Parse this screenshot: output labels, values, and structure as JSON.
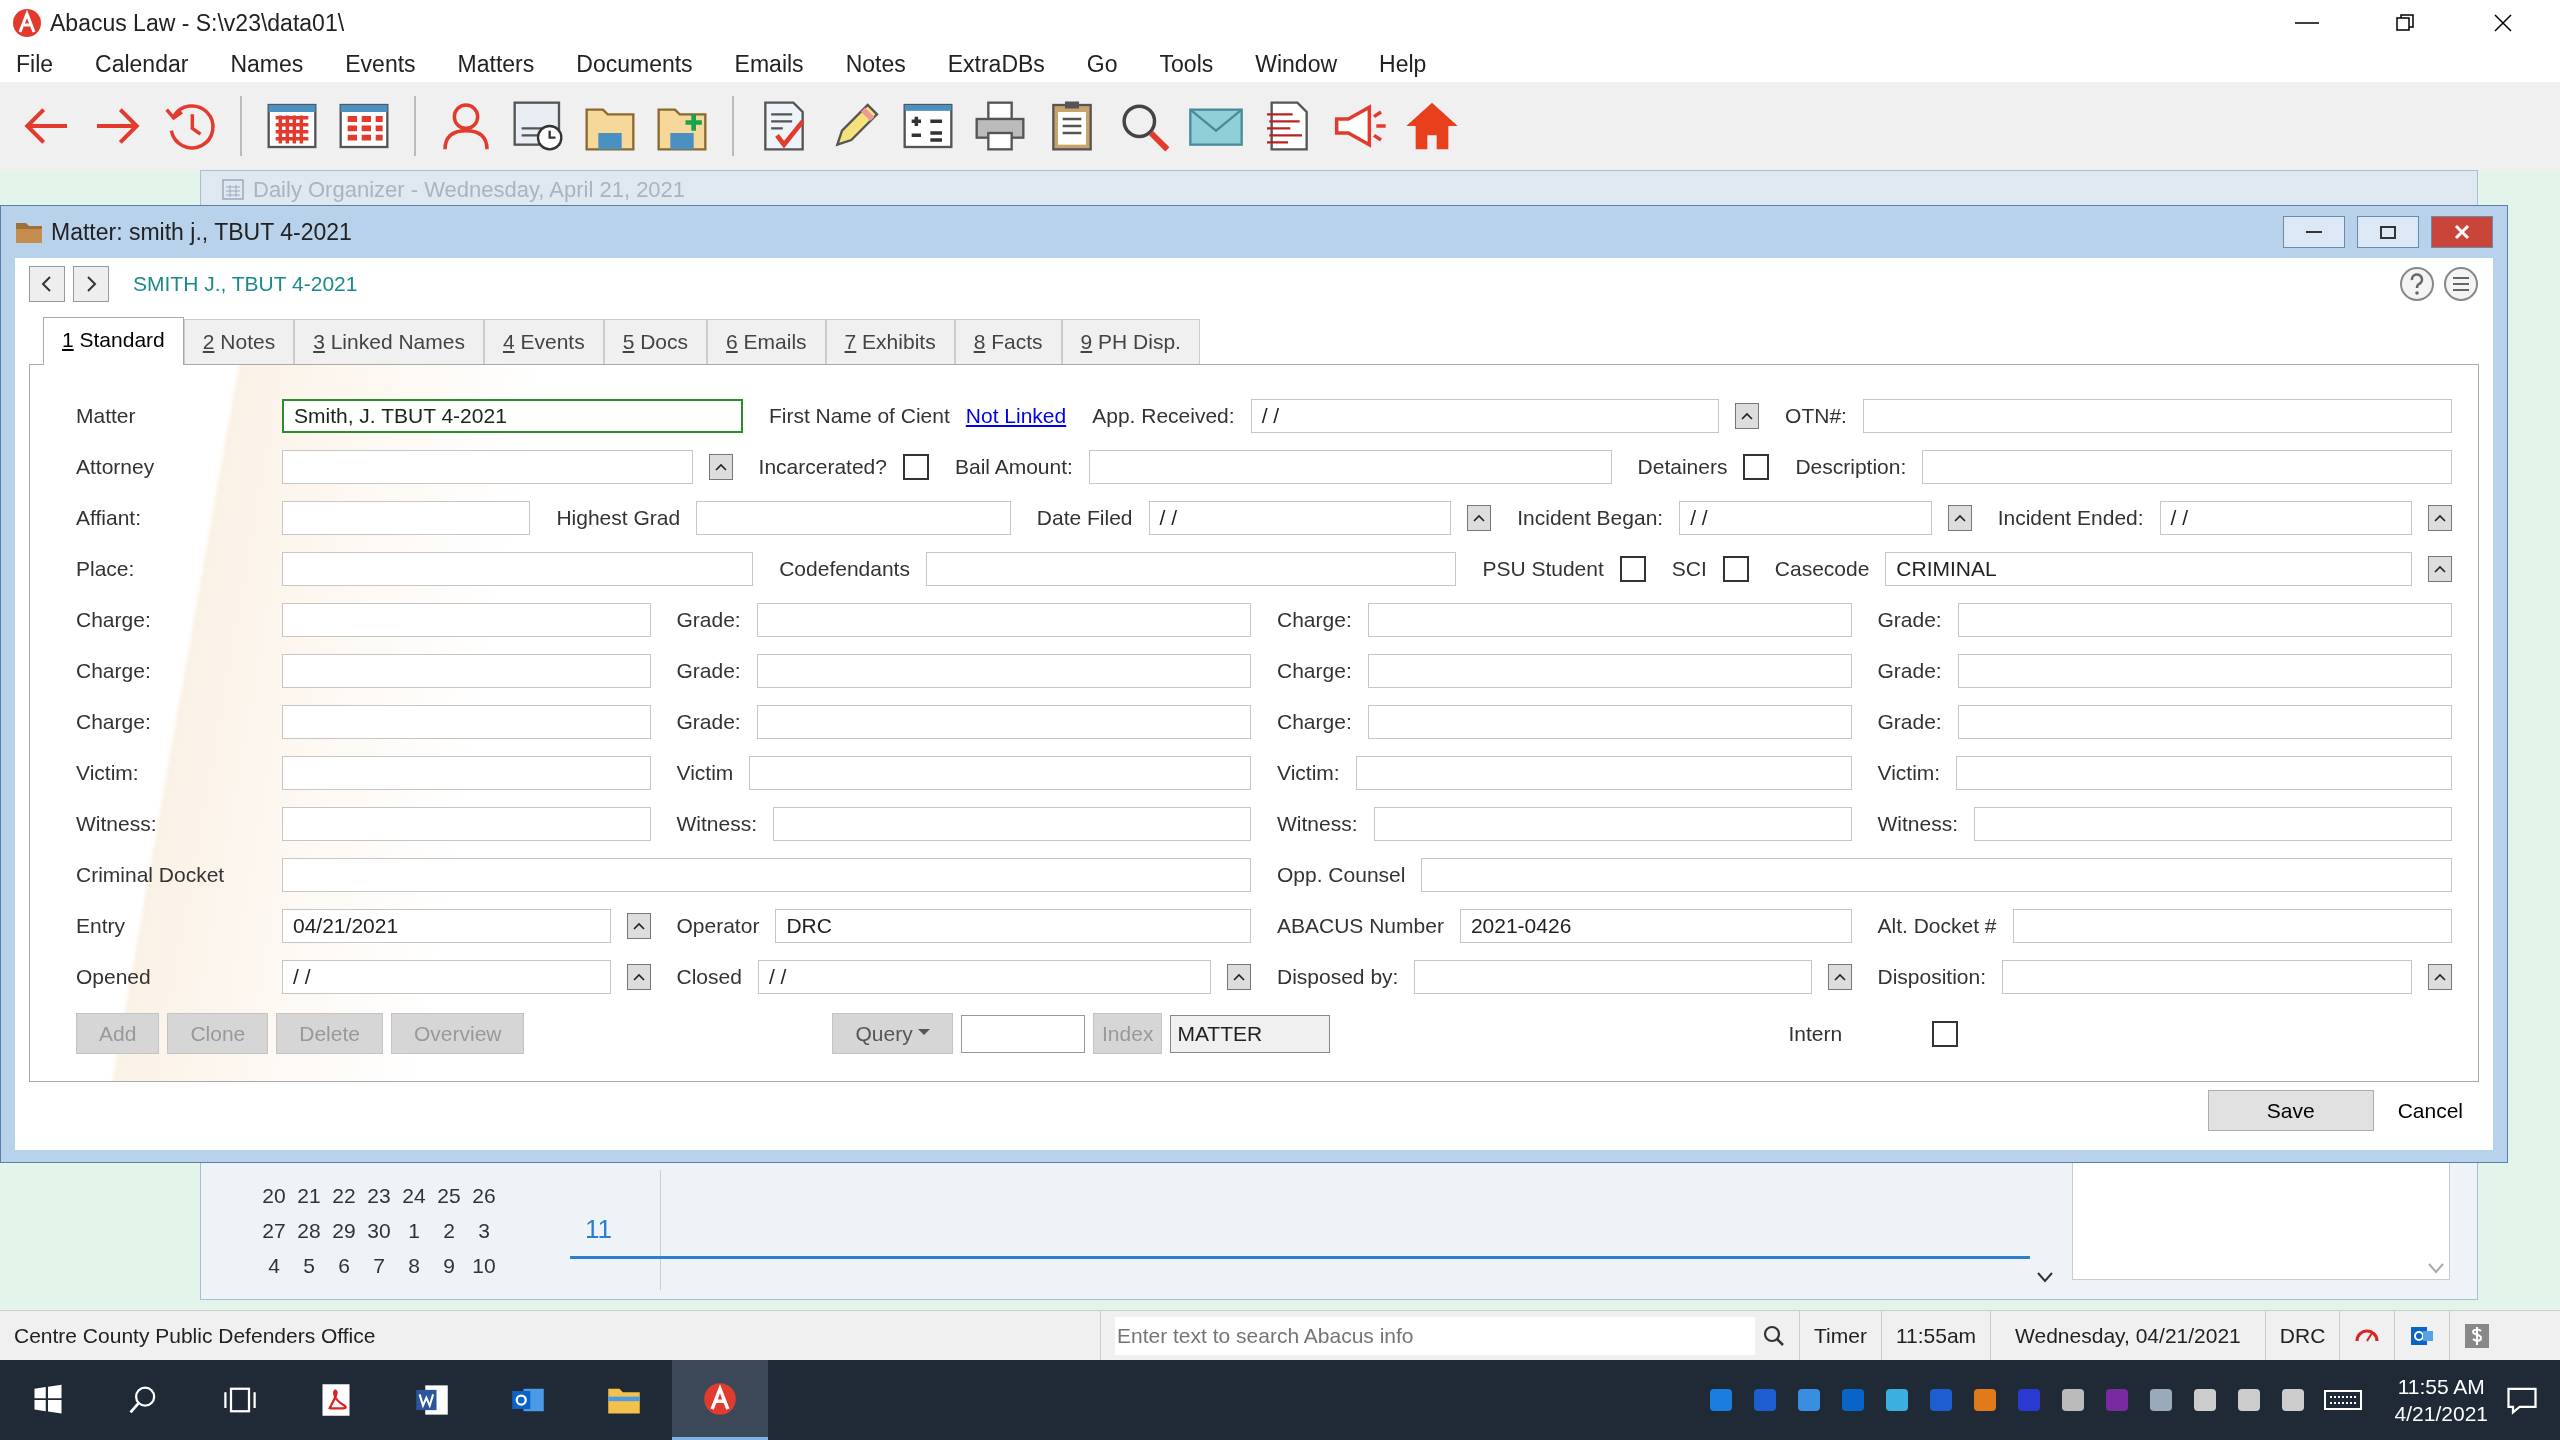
{
  "window": {
    "title": "Abacus Law  -  S:\\v23\\data01\\"
  },
  "menu": [
    "File",
    "Calendar",
    "Names",
    "Events",
    "Matters",
    "Documents",
    "Emails",
    "Notes",
    "ExtraDBs",
    "Go",
    "Tools",
    "Window",
    "Help"
  ],
  "organizer": {
    "title": "Daily Organizer - Wednesday, April 21, 2021",
    "weeks": [
      [
        "20",
        "21",
        "22",
        "23",
        "24",
        "25",
        "26"
      ],
      [
        "27",
        "28",
        "29",
        "30",
        "1",
        "2",
        "3"
      ],
      [
        "4",
        "5",
        "6",
        "7",
        "8",
        "9",
        "10"
      ]
    ],
    "hour": "11"
  },
  "dialog": {
    "title": "Matter: smith j., TBUT 4-2021",
    "breadcrumb": "SMITH J., TBUT 4-2021",
    "tabs": [
      {
        "label": "1 Standard",
        "selected": true
      },
      {
        "label": "2 Notes",
        "selected": false
      },
      {
        "label": "3 Linked Names",
        "selected": false
      },
      {
        "label": "4 Events",
        "selected": false
      },
      {
        "label": "5 Docs",
        "selected": false
      },
      {
        "label": "6 Emails",
        "selected": false
      },
      {
        "label": "7 Exhibits",
        "selected": false
      },
      {
        "label": "8 Facts",
        "selected": false
      },
      {
        "label": "9 PH Disp.",
        "selected": false
      }
    ],
    "lines": [
      {
        "fields": [
          {
            "label": "Matter",
            "kind": "text",
            "value": "Smith, J. TBUT 4-2021",
            "focused": true
          },
          {
            "label": "First Name of Cient",
            "kind": "link",
            "value": "Not Linked"
          },
          {
            "label": "App. Received:",
            "kind": "text",
            "value": "/ /",
            "picker": true
          },
          {
            "label": "OTN#:",
            "kind": "text"
          }
        ]
      },
      {
        "fields": [
          {
            "label": "Attorney",
            "kind": "text",
            "picker": true
          },
          {
            "label": "Incarcerated?",
            "kind": "checkbox",
            "checked": false
          },
          {
            "label": "Bail Amount:",
            "kind": "text"
          },
          {
            "label": "Detainers",
            "kind": "checkbox",
            "checked": false
          },
          {
            "label": "Description:",
            "kind": "text"
          }
        ]
      },
      {
        "fields": [
          {
            "label": "Affiant:",
            "kind": "text"
          },
          {
            "label": "Highest Grad",
            "kind": "text"
          },
          {
            "label": "Date Filed",
            "kind": "text",
            "value": "/ /",
            "picker": true
          },
          {
            "label": "Incident Began:",
            "kind": "text",
            "value": "/ /",
            "picker": true
          },
          {
            "label": "Incident Ended:",
            "kind": "text",
            "value": "/ /",
            "picker": true
          }
        ]
      },
      {
        "fields": [
          {
            "label": "Place:",
            "kind": "text"
          },
          {
            "label": "Codefendants",
            "kind": "text"
          },
          {
            "label": "PSU Student",
            "kind": "checkbox",
            "checked": false
          },
          {
            "label": "SCI",
            "kind": "checkbox",
            "checked": false
          },
          {
            "label": "Casecode",
            "kind": "text",
            "value": "CRIMINAL",
            "picker": true
          }
        ]
      },
      {
        "fields": [
          {
            "label": "Charge:",
            "kind": "text"
          },
          {
            "label": "Grade:",
            "kind": "text"
          },
          {
            "label": "Charge:",
            "kind": "text"
          },
          {
            "label": "Grade:",
            "kind": "text"
          }
        ]
      },
      {
        "fields": [
          {
            "label": "Charge:",
            "kind": "text"
          },
          {
            "label": "Grade:",
            "kind": "text"
          },
          {
            "label": "Charge:",
            "kind": "text"
          },
          {
            "label": "Grade:",
            "kind": "text"
          }
        ]
      },
      {
        "fields": [
          {
            "label": "Charge:",
            "kind": "text"
          },
          {
            "label": "Grade:",
            "kind": "text"
          },
          {
            "label": "Charge:",
            "kind": "text"
          },
          {
            "label": "Grade:",
            "kind": "text"
          }
        ]
      },
      {
        "fields": [
          {
            "label": "Victim:",
            "kind": "text"
          },
          {
            "label": "Victim",
            "kind": "text"
          },
          {
            "label": "Victim:",
            "kind": "text"
          },
          {
            "label": "Victim:",
            "kind": "text"
          }
        ]
      },
      {
        "fields": [
          {
            "label": "Witness:",
            "kind": "text"
          },
          {
            "label": "Witness:",
            "kind": "text"
          },
          {
            "label": "Witness:",
            "kind": "text"
          },
          {
            "label": "Witness:",
            "kind": "text"
          }
        ]
      },
      {
        "fields": [
          {
            "label": "Criminal Docket",
            "kind": "text"
          },
          {
            "label": "Opp. Counsel",
            "kind": "text"
          }
        ]
      },
      {
        "fields": [
          {
            "label": "Entry",
            "kind": "text",
            "value": "04/21/2021",
            "picker": true
          },
          {
            "label": "Operator",
            "kind": "text",
            "value": "DRC"
          },
          {
            "label": "ABACUS Number",
            "kind": "text",
            "value": "2021-0426"
          },
          {
            "label": "Alt. Docket #",
            "kind": "text"
          }
        ]
      },
      {
        "fields": [
          {
            "label": "Opened",
            "kind": "text",
            "value": "/ /",
            "picker": true
          },
          {
            "label": "Closed",
            "kind": "text",
            "value": "/ /",
            "picker": true
          },
          {
            "label": "Disposed by:",
            "kind": "text",
            "picker": true
          },
          {
            "label": "Disposition:",
            "kind": "text",
            "picker": true
          }
        ]
      }
    ],
    "actions": [
      {
        "label": "Add",
        "disabled": true
      },
      {
        "label": "Clone",
        "disabled": true
      },
      {
        "label": "Delete",
        "disabled": true
      },
      {
        "label": "Overview",
        "disabled": true
      }
    ],
    "query": {
      "label": "Query"
    },
    "index": {
      "label": "Index",
      "disabled": true,
      "value": "MATTER"
    },
    "intern": {
      "label": "Intern",
      "checked": false
    },
    "save": "Save",
    "cancel": "Cancel"
  },
  "status_bar": {
    "office": "Centre County Public Defenders Office",
    "search_placeholder": "Enter text to search Abacus info",
    "timer": "Timer",
    "time": "11:55am",
    "date": "Wednesday, 04/21/2021",
    "operator": "DRC"
  },
  "taskbar": {
    "time": "11:55 AM",
    "date": "4/21/2021"
  }
}
